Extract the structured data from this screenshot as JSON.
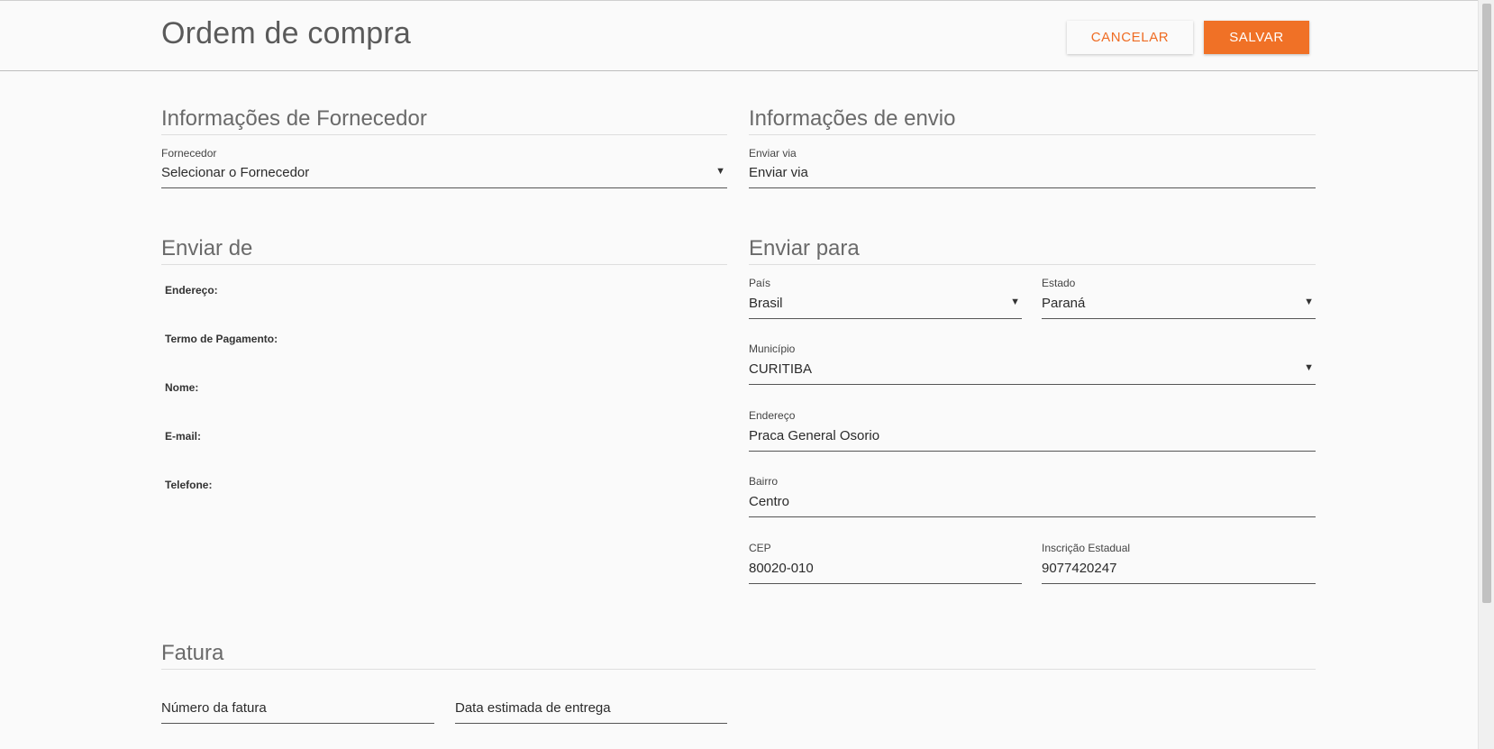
{
  "header": {
    "title": "Ordem de compra",
    "cancel_label": "CANCELAR",
    "save_label": "SALVAR"
  },
  "supplier_info": {
    "title": "Informações de Fornecedor",
    "supplier_label": "Fornecedor",
    "supplier_value": "Selecionar o Fornecedor"
  },
  "shipping_info": {
    "title": "Informações de envio",
    "ship_via_label": "Enviar via",
    "ship_via_value": "Enviar via"
  },
  "ship_from": {
    "title": "Enviar de",
    "address_label": "Endereço:",
    "payment_term_label": "Termo de Pagamento:",
    "name_label": "Nome:",
    "email_label": "E-mail:",
    "phone_label": "Telefone:"
  },
  "ship_to": {
    "title": "Enviar para",
    "country_label": "País",
    "country_value": "Brasil",
    "state_label": "Estado",
    "state_value": "Paraná",
    "city_label": "Município",
    "city_value": "CURITIBA",
    "address_label": "Endereço",
    "address_value": "Praca General Osorio",
    "district_label": "Bairro",
    "district_value": "Centro",
    "zip_label": "CEP",
    "zip_value": "80020-010",
    "state_reg_label": "Inscrição Estadual",
    "state_reg_value": "9077420247"
  },
  "invoice": {
    "title": "Fatura",
    "number_placeholder": "Número da fatura",
    "delivery_placeholder": "Data estimada de entrega"
  },
  "icons": {
    "dropdown": "caret-down-icon"
  },
  "colors": {
    "accent": "#f07126",
    "background": "#fafafa"
  }
}
